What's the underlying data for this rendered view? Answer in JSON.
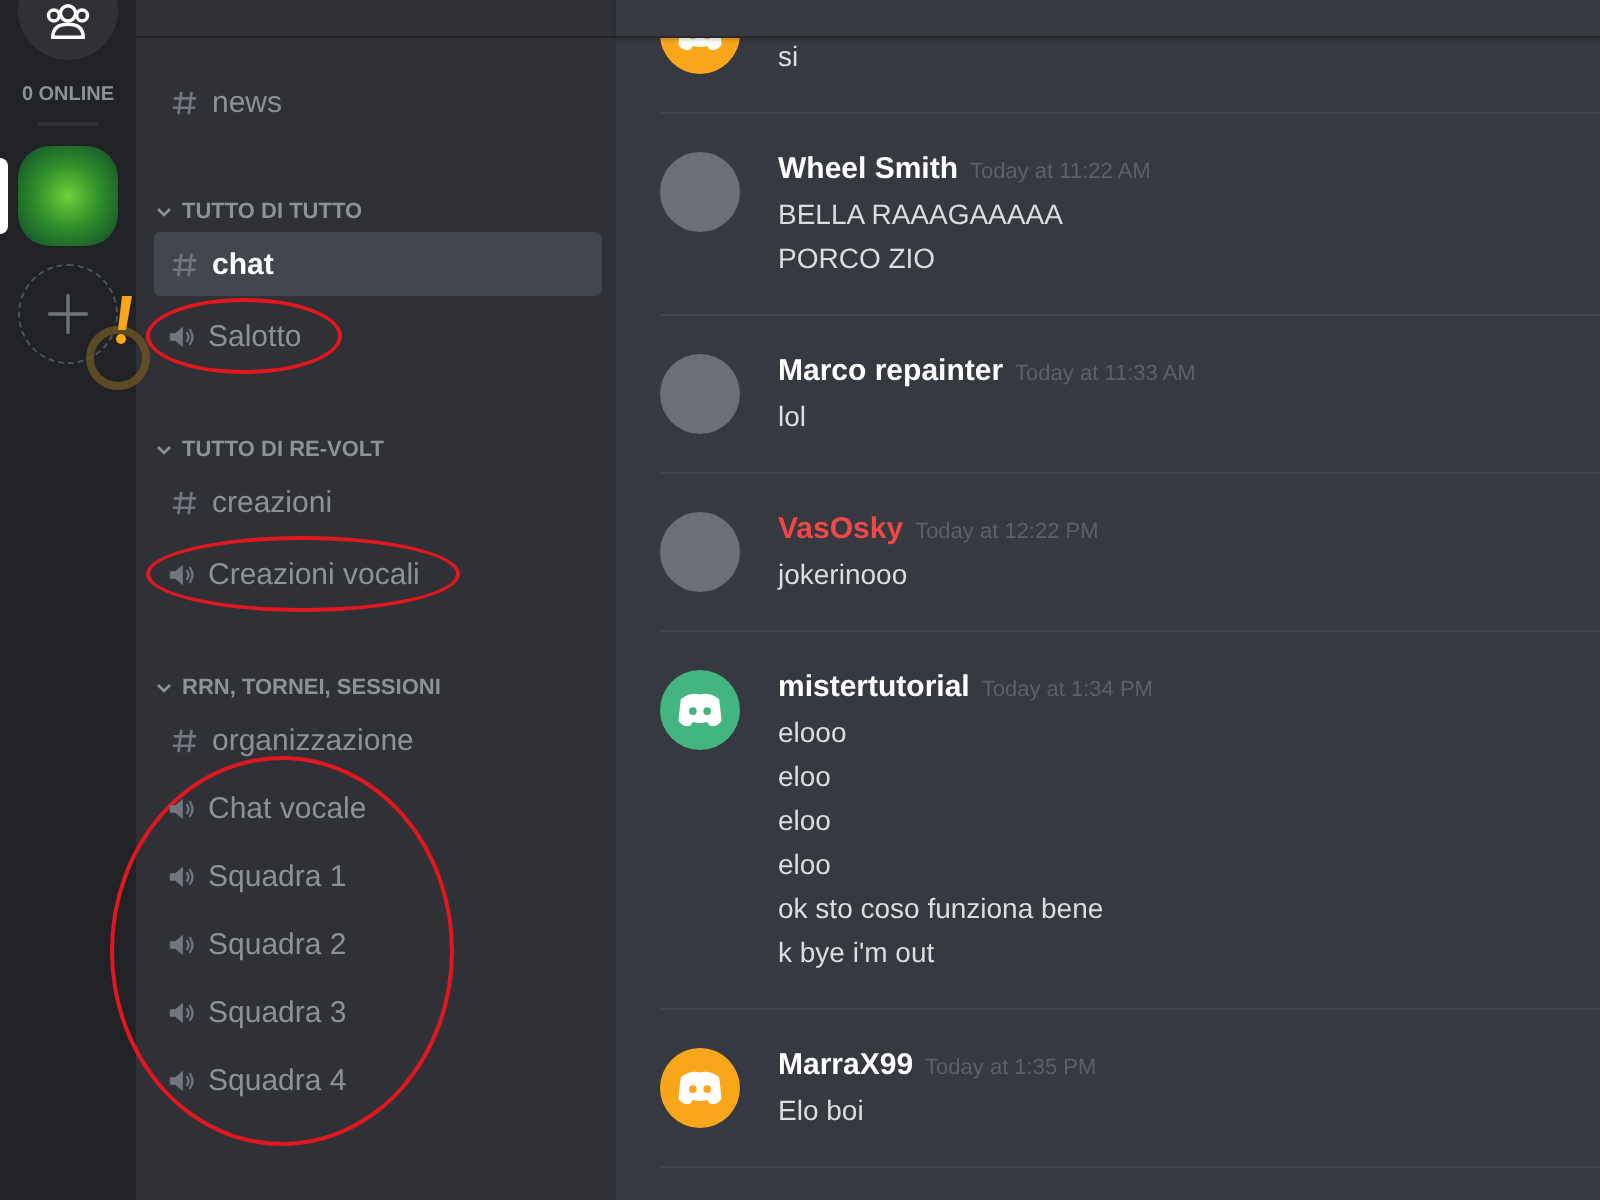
{
  "guild_bar": {
    "online_count": "0 ONLINE",
    "servers": [
      {
        "selected": true
      }
    ]
  },
  "channels": {
    "top": [
      {
        "name": "news",
        "kind": "text",
        "selected": false,
        "circled": false
      }
    ],
    "categories": [
      {
        "name": "TUTTO DI TUTTO",
        "expanded": true,
        "channels": [
          {
            "name": "chat",
            "kind": "text",
            "selected": true,
            "circled": false
          },
          {
            "name": "Salotto",
            "kind": "voice",
            "selected": false,
            "circled": true
          }
        ]
      },
      {
        "name": "TUTTO DI RE-VOLT",
        "expanded": true,
        "channels": [
          {
            "name": "creazioni",
            "kind": "text",
            "selected": false,
            "circled": false
          },
          {
            "name": "Creazioni vocali",
            "kind": "voice",
            "selected": false,
            "circled": true
          }
        ]
      },
      {
        "name": "RRN, TORNEI, SESSIONI",
        "expanded": true,
        "channels": [
          {
            "name": "organizzazione",
            "kind": "text",
            "selected": false,
            "circled": false
          },
          {
            "name": "Chat vocale",
            "kind": "voice",
            "selected": false,
            "circled": true
          },
          {
            "name": "Squadra 1",
            "kind": "voice",
            "selected": false,
            "circled": true
          },
          {
            "name": "Squadra 2",
            "kind": "voice",
            "selected": false,
            "circled": true
          },
          {
            "name": "Squadra 3",
            "kind": "voice",
            "selected": false,
            "circled": true
          },
          {
            "name": "Squadra 4",
            "kind": "voice",
            "selected": false,
            "circled": true
          }
        ]
      }
    ]
  },
  "messages": [
    {
      "avatar": {
        "kind": "default",
        "color": "#faa61a"
      },
      "lines": [
        "si"
      ]
    },
    {
      "author": "Wheel Smith",
      "color": "#ffffff",
      "time": "Today at 11:22 AM",
      "avatar": {
        "kind": "photo"
      },
      "lines": [
        "BELLA RAAAGAAAAA",
        "PORCO ZIO"
      ]
    },
    {
      "author": "Marco repainter",
      "color": "#ffffff",
      "time": "Today at 11:33 AM",
      "avatar": {
        "kind": "photo"
      },
      "lines": [
        "lol"
      ]
    },
    {
      "author": "VasOsky",
      "color": "#f04747",
      "time": "Today at 12:22 PM",
      "avatar": {
        "kind": "photo"
      },
      "lines": [
        "jokerinooo"
      ]
    },
    {
      "author": "mistertutorial",
      "color": "#ffffff",
      "time": "Today at 1:34 PM",
      "avatar": {
        "kind": "default",
        "color": "#43b581"
      },
      "lines": [
        "elooo",
        "eloo",
        "eloo",
        "eloo",
        "ok sto coso funziona bene",
        "k bye i'm out"
      ]
    },
    {
      "author": "MarraX99",
      "color": "#ffffff",
      "time": "Today at 1:35 PM",
      "avatar": {
        "kind": "default",
        "color": "#faa61a"
      },
      "lines": [
        "Elo boi"
      ]
    }
  ]
}
